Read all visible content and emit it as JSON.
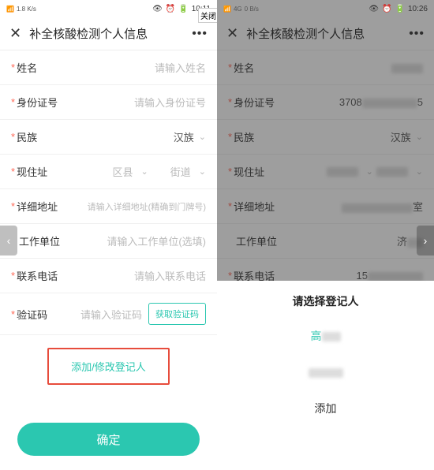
{
  "statusbar_left": {
    "speed": "1.8 K/s",
    "time": "10:11",
    "signal": "⁴⁶ ⁴⁶"
  },
  "statusbar_right": {
    "speed": "0 B/s",
    "time": "10:26",
    "net": "4G"
  },
  "close_tag": "关闭",
  "header": {
    "title": "补全核酸检测个人信息",
    "more": "•••"
  },
  "labels": {
    "name": "姓名",
    "id": "身份证号",
    "ethnic": "民族",
    "addr": "现住址",
    "detail": "详细地址",
    "work": "工作单位",
    "phone": "联系电话",
    "code": "验证码"
  },
  "placeholders": {
    "name": "请输入姓名",
    "id": "请输入身份证号",
    "district": "区县",
    "street": "街道",
    "detail": "请输入详细地址(精确到门牌号)",
    "work": "请输入工作单位(选填)",
    "phone": "请输入联系电话",
    "code": "请输入验证码"
  },
  "values": {
    "ethnic": "汉族",
    "id_masked_prefix": "3708",
    "id_masked_suffix": "5",
    "phone_prefix": "15",
    "work_prefix": "济",
    "detail_suffix": "室"
  },
  "buttons": {
    "get_code": "获取验证码",
    "add_edit": "添加/修改登记人",
    "submit": "确定"
  },
  "sheet": {
    "title": "请选择登记人",
    "item1": "高",
    "item2": " ",
    "add": "添加"
  }
}
